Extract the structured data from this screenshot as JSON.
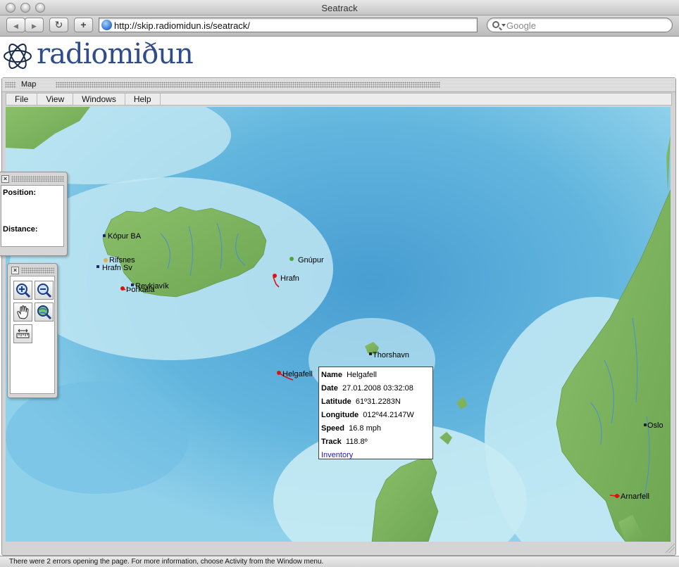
{
  "window": {
    "title": "Seatrack"
  },
  "toolbar": {
    "back_glyph": "◀",
    "forward_glyph": "▶",
    "reload_glyph": "↻",
    "add_glyph": "+",
    "url": "http://skip.radiomidun.is/seatrack/",
    "search_placeholder": "Google"
  },
  "site": {
    "logo_text": "radiomiðun"
  },
  "app": {
    "title": "Map",
    "menu": [
      "File",
      "View",
      "Windows",
      "Help"
    ]
  },
  "position_panel": {
    "close_glyph": "×",
    "position_label": "Position:",
    "distance_label": "Distance:"
  },
  "tools": [
    "zoom-in-icon",
    "zoom-out-icon",
    "pan-hand-icon",
    "zoom-globe-icon",
    "measure-ruler-icon"
  ],
  "map": {
    "places": [
      {
        "name": "Kópur BA"
      },
      {
        "name": "Rifsnes"
      },
      {
        "name": "Hrafn Sv"
      },
      {
        "name": "Reykjavík"
      },
      {
        "name": "Þorkatla"
      },
      {
        "name": "Gnúpur"
      },
      {
        "name": "Hrafn"
      },
      {
        "name": "Thorshavn"
      },
      {
        "name": "Helgafell"
      },
      {
        "name": "Oslo"
      },
      {
        "name": "Arnarfell"
      }
    ],
    "colors": {
      "ocean_deep": "#4fa6d6",
      "ocean_shallow": "#bfe6f2",
      "land": "#7fb661",
      "track": "#e01010"
    }
  },
  "info": {
    "name_label": "Name",
    "name": "Helgafell",
    "date_label": "Date",
    "date": "27.01.2008 03:32:08",
    "lat_label": "Latitude",
    "lat": "61º31.2283N",
    "lon_label": "Longitude",
    "lon": "012º44.2147W",
    "speed_label": "Speed",
    "speed": "16.8 mph",
    "track_label": "Track",
    "track": "118.8º",
    "link": "Inventory"
  },
  "status": {
    "text": "There were 2 errors opening the page. For more information, choose Activity from the Window menu."
  }
}
